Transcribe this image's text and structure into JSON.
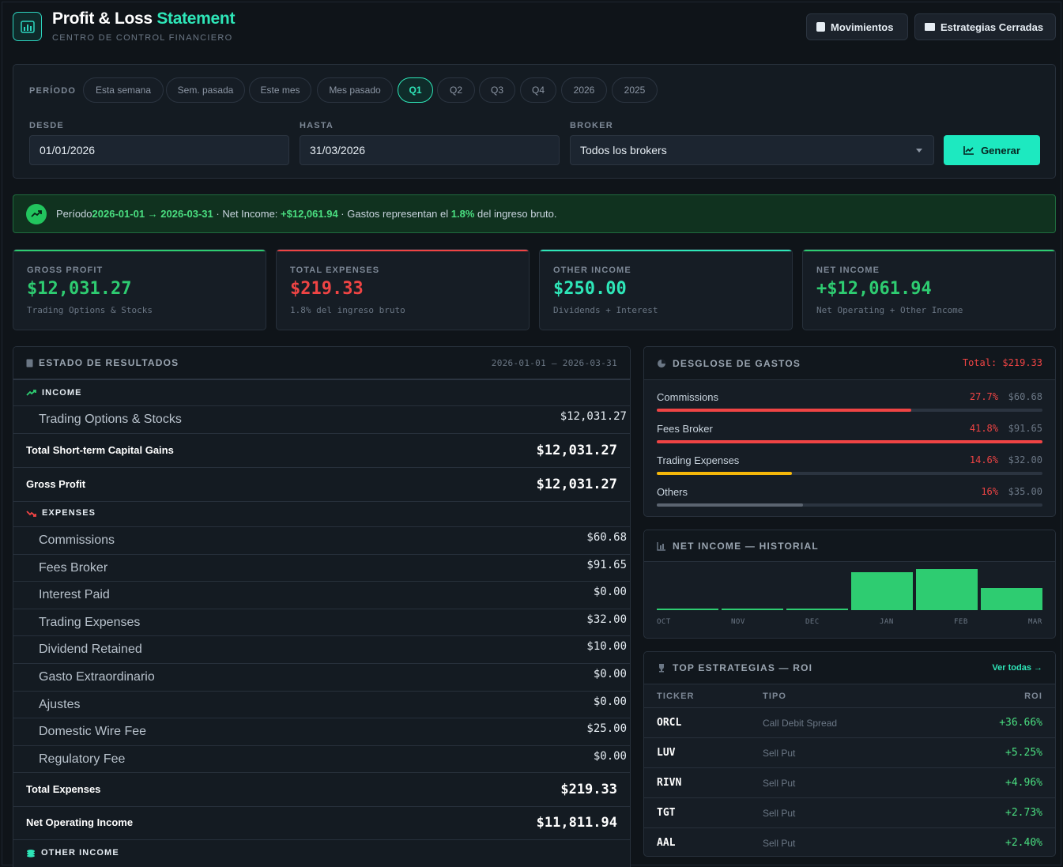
{
  "header": {
    "title_main": "Profit & Loss",
    "title_accent": "Statement",
    "subtitle": "CENTRO DE CONTROL FINANCIERO",
    "btn_movimientos": "Movimientos",
    "btn_estrategias": "Estrategias Cerradas"
  },
  "filters": {
    "periodo_label": "PERÍODO",
    "chips": [
      "Esta semana",
      "Sem. pasada",
      "Este mes",
      "Mes pasado",
      "Q1",
      "Q2",
      "Q3",
      "Q4",
      "2026",
      "2025"
    ],
    "active_chip": "Q1",
    "desde_label": "DESDE",
    "desde_value": "01/01/2026",
    "hasta_label": "HASTA",
    "hasta_value": "31/03/2026",
    "broker_label": "BROKER",
    "broker_value": "Todos los brokers",
    "generate_label": "Generar"
  },
  "banner": {
    "t1": "Período ",
    "range": "2026-01-01 → 2026-03-31",
    "t2": " · Net Income: ",
    "net": "+$12,061.94",
    "t3": " · Gastos representan el ",
    "pct": "1.8%",
    "t4": " del ingreso bruto."
  },
  "kpis": [
    {
      "label": "GROSS PROFIT",
      "value": "$12,031.27",
      "sub": "Trading Options & Stocks",
      "color": "#2ecc71"
    },
    {
      "label": "TOTAL EXPENSES",
      "value": "$219.33",
      "sub": "1.8% del ingreso bruto",
      "color": "#ef4444"
    },
    {
      "label": "OTHER INCOME",
      "value": "$250.00",
      "sub": "Dividends + Interest",
      "color": "#2ee6b8"
    },
    {
      "label": "NET INCOME",
      "value": "+$12,061.94",
      "sub": "Net Operating + Other Income",
      "color": "#2ecc71"
    }
  ],
  "statement": {
    "title": "ESTADO DE RESULTADOS",
    "range": "2026-01-01 — 2026-03-31",
    "income_label": "INCOME",
    "income_rows": [
      {
        "label": "Trading Options & Stocks",
        "value": "$12,031.27"
      }
    ],
    "total_st_label": "Total Short-term Capital Gains",
    "total_st_value": "$12,031.27",
    "gross_label": "Gross Profit",
    "gross_value": "$12,031.27",
    "expenses_label": "EXPENSES",
    "expense_rows": [
      {
        "label": "Commissions",
        "value": "$60.68"
      },
      {
        "label": "Fees Broker",
        "value": "$91.65"
      },
      {
        "label": "Interest Paid",
        "value": "$0.00"
      },
      {
        "label": "Trading Expenses",
        "value": "$32.00"
      },
      {
        "label": "Dividend Retained",
        "value": "$10.00"
      },
      {
        "label": "Gasto Extraordinario",
        "value": "$0.00"
      },
      {
        "label": "Ajustes",
        "value": "$0.00"
      },
      {
        "label": "Domestic Wire Fee",
        "value": "$25.00"
      },
      {
        "label": "Regulatory Fee",
        "value": "$0.00"
      }
    ],
    "total_exp_label": "Total Expenses",
    "total_exp_value": "$219.33",
    "noi_label": "Net Operating Income",
    "noi_value": "$11,811.94",
    "other_income_label": "OTHER INCOME"
  },
  "breakdown": {
    "title": "DESGLOSE DE GASTOS",
    "total": "Total: $219.33",
    "items": [
      {
        "name": "Commissions",
        "pct": "27.7%",
        "amount": "$60.68",
        "fill": 0.66,
        "color": "#ef4444"
      },
      {
        "name": "Fees Broker",
        "pct": "41.8%",
        "amount": "$91.65",
        "fill": 1.0,
        "color": "#ef4444"
      },
      {
        "name": "Trading Expenses",
        "pct": "14.6%",
        "amount": "$32.00",
        "fill": 0.35,
        "color": "#f5b70a"
      },
      {
        "name": "Others",
        "pct": "16%",
        "amount": "$35.00",
        "fill": 0.38,
        "color": "#5b6470"
      }
    ]
  },
  "history": {
    "title": "NET INCOME — HISTORIAL",
    "chart_data": {
      "type": "bar",
      "categories": [
        "OCT",
        "NOV",
        "DEC",
        "JAN",
        "FEB",
        "MAR"
      ],
      "values": [
        0.03,
        0.03,
        0.03,
        0.92,
        1.0,
        0.53
      ]
    }
  },
  "top": {
    "title": "TOP ESTRATEGIAS — ROI",
    "link": "Ver todas →",
    "headers": [
      "TICKER",
      "TIPO",
      "ROI"
    ],
    "rows": [
      {
        "ticker": "ORCL",
        "type": "Call Debit Spread",
        "roi": "+36.66%"
      },
      {
        "ticker": "LUV",
        "type": "Sell Put",
        "roi": "+5.25%"
      },
      {
        "ticker": "RIVN",
        "type": "Sell Put",
        "roi": "+4.96%"
      },
      {
        "ticker": "TGT",
        "type": "Sell Put",
        "roi": "+2.73%"
      },
      {
        "ticker": "AAL",
        "type": "Sell Put",
        "roi": "+2.40%"
      }
    ]
  }
}
